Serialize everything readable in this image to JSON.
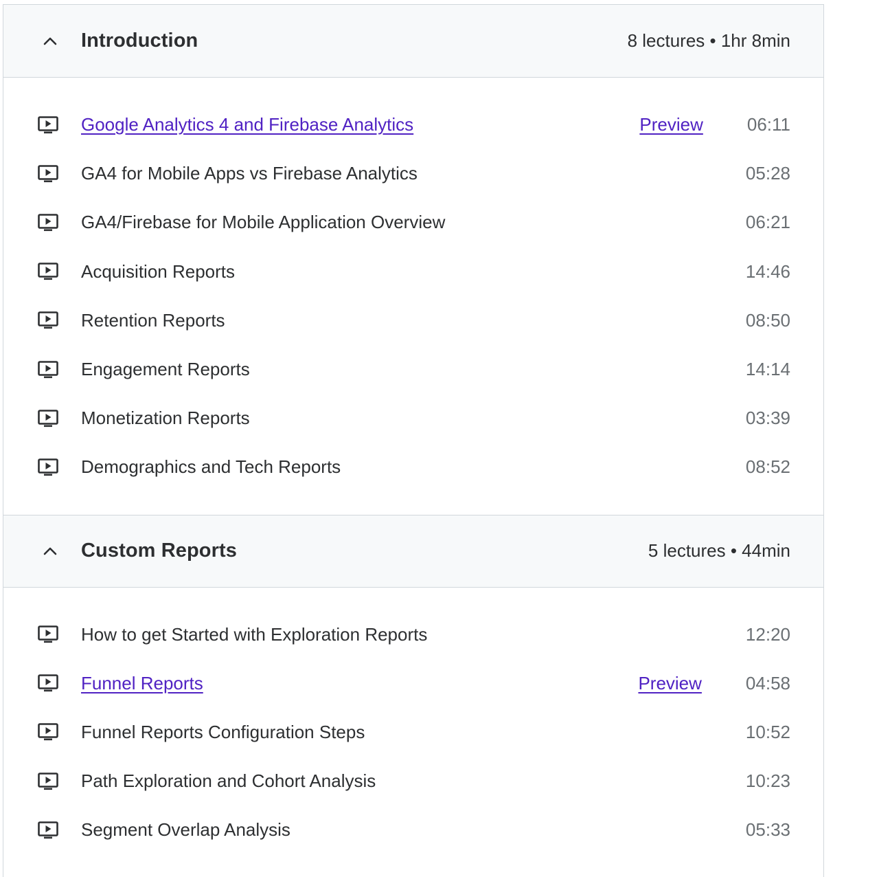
{
  "sections": [
    {
      "title": "Introduction",
      "meta": "8 lectures • 1hr 8min",
      "icon": "chevron-up-icon",
      "lectures": [
        {
          "title": "Google Analytics 4 and Firebase Analytics",
          "duration": "06:11",
          "preview": "Preview"
        },
        {
          "title": "GA4 for Mobile Apps vs Firebase Analytics",
          "duration": "05:28"
        },
        {
          "title": "GA4/Firebase for Mobile Application Overview",
          "duration": "06:21"
        },
        {
          "title": "Acquisition Reports",
          "duration": "14:46"
        },
        {
          "title": "Retention Reports",
          "duration": "08:50"
        },
        {
          "title": "Engagement Reports",
          "duration": "14:14"
        },
        {
          "title": "Monetization Reports",
          "duration": "03:39"
        },
        {
          "title": "Demographics and Tech Reports",
          "duration": "08:52"
        }
      ]
    },
    {
      "title": "Custom Reports",
      "meta": "5 lectures • 44min",
      "icon": "chevron-up-icon",
      "lectures": [
        {
          "title": "How to get Started with Exploration Reports",
          "duration": "12:20"
        },
        {
          "title": "Funnel Reports",
          "duration": "04:58",
          "preview": "Preview"
        },
        {
          "title": "Funnel Reports Configuration Steps",
          "duration": "10:52"
        },
        {
          "title": "Path Exploration and Cohort Analysis",
          "duration": "10:23"
        },
        {
          "title": "Segment Overlap Analysis",
          "duration": "05:33"
        }
      ]
    }
  ],
  "lecture_icon": "video-play-icon",
  "colors": {
    "link": "#5022c3",
    "text": "#2d2f31",
    "muted": "#6a6f73",
    "header_bg": "#f7f9fa",
    "border": "#d1d7dc"
  }
}
